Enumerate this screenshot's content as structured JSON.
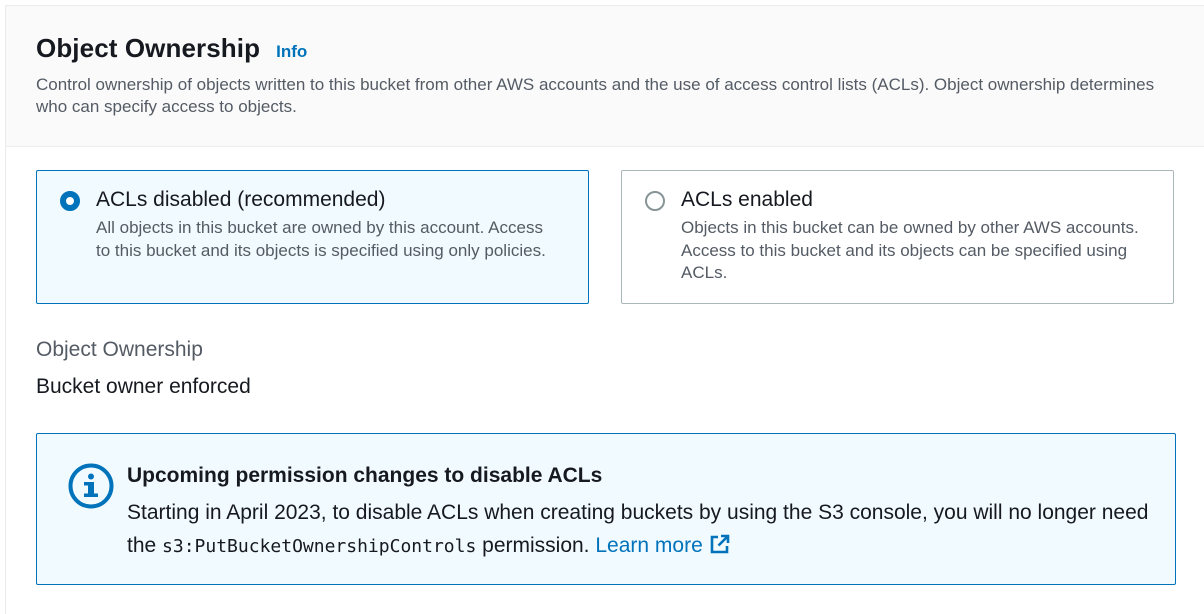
{
  "section": {
    "title": "Object Ownership",
    "info_link": "Info",
    "description": "Control ownership of objects written to this bucket from other AWS accounts and the use of access control lists (ACLs). Object ownership determines who can specify access to objects."
  },
  "options": [
    {
      "label": "ACLs disabled (recommended)",
      "description": "All objects in this bucket are owned by this account. Access to this bucket and its objects is specified using only policies.",
      "selected": true
    },
    {
      "label": "ACLs enabled",
      "description": "Objects in this bucket can be owned by other AWS accounts. Access to this bucket and its objects can be specified using ACLs.",
      "selected": false
    }
  ],
  "ownership_field": {
    "label": "Object Ownership",
    "value": "Bucket owner enforced"
  },
  "alert": {
    "title": "Upcoming permission changes to disable ACLs",
    "body_before": "Starting in April 2023, to disable ACLs when creating buckets by using the S3 console, you will no longer need the ",
    "code": "s3:PutBucketOwnershipControls",
    "body_after": " permission. ",
    "learn_more": "Learn more",
    "icon": "info-circle-icon"
  },
  "colors": {
    "accent": "#0073bb",
    "selected_bg": "#f1faff",
    "text": "#16191f",
    "secondary_text": "#545b64"
  }
}
